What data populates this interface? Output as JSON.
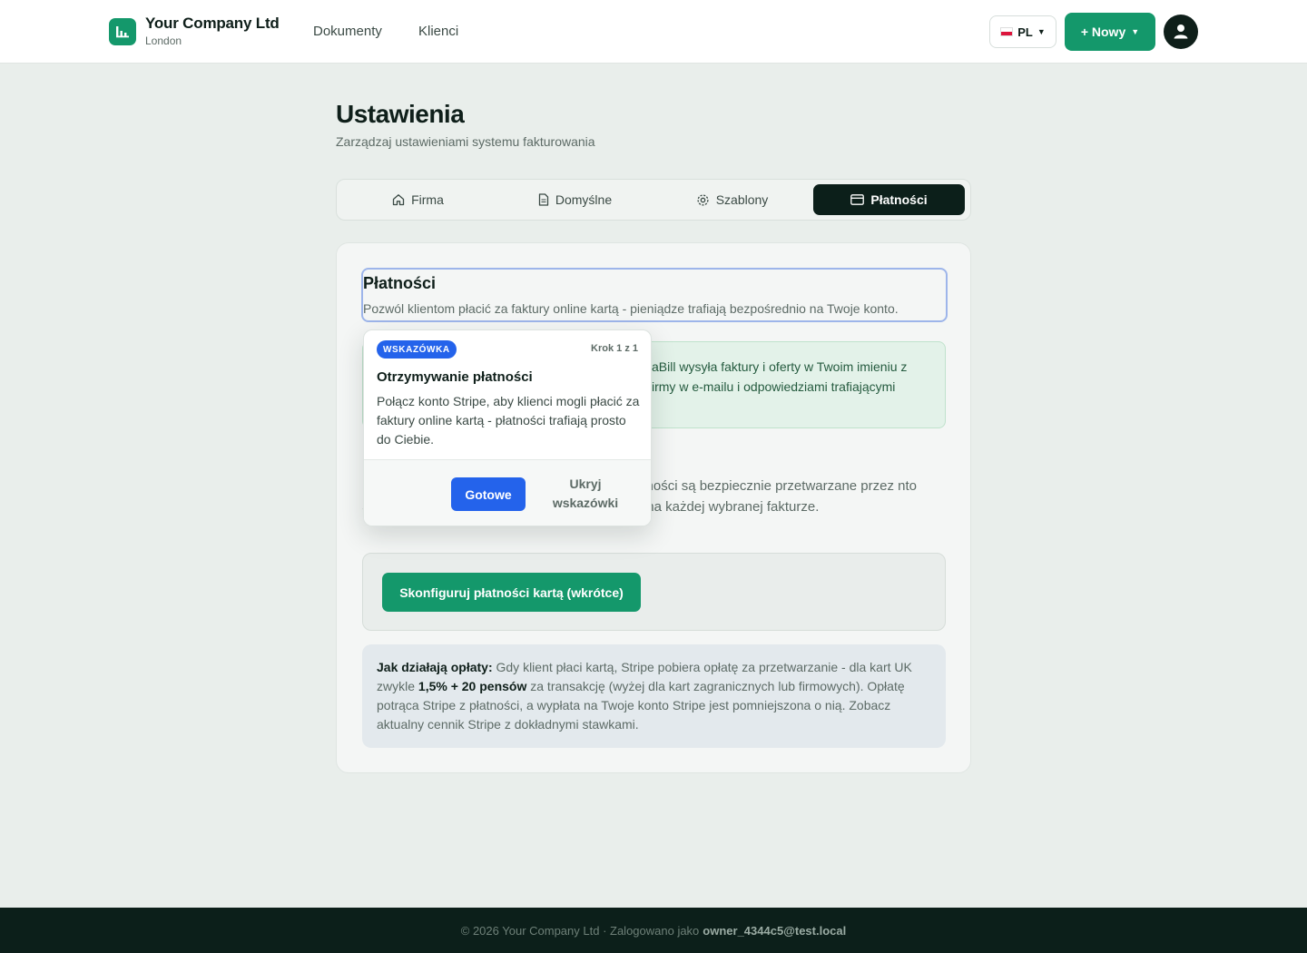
{
  "header": {
    "company_name": "Your Company Ltd",
    "company_city": "London",
    "nav": [
      "Dokumenty",
      "Klienci"
    ],
    "language": "PL",
    "new_button": "+ Nowy"
  },
  "page": {
    "title": "Ustawienia",
    "subtitle": "Zarządzaj ustawieniami systemu fakturowania"
  },
  "tabs": [
    {
      "label": "Firma",
      "icon": "home-icon",
      "active": false
    },
    {
      "label": "Domyślne",
      "icon": "document-icon",
      "active": false
    },
    {
      "label": "Szablony",
      "icon": "gear-icon",
      "active": false
    },
    {
      "label": "Płatności",
      "icon": "credit-card-icon",
      "active": true
    }
  ],
  "section": {
    "title": "Płatności",
    "description": "Pozwól klientom płacić za faktury online kartą - pieniądze trafiają bezpośrednio na Twoje konto."
  },
  "info_box": {
    "text": "aBill wysyła faktury i oferty w Twoim imieniu z irmy w e-mailu i odpowiedziami trafiającymi"
  },
  "body_text": "atności są bezpiecznie przetwarzane przez nto Stripe. Otrzymujesz bezpieczny link \"Pay now\" na każdej wybranej fakturze.",
  "setup_button": "Skonfiguruj płatności kartą (wkrótce)",
  "fees": {
    "label": "Jak działają opłaty:",
    "text_1": " Gdy klient płaci kartą, Stripe pobiera opłatę za przetwarzanie - dla kart UK zwykle ",
    "highlight": "1,5% + 20 pensów",
    "text_2": " za transakcję (wyżej dla kart zagranicznych lub firmowych). Opłatę potrąca Stripe z płatności, a wypłata na Twoje konto Stripe jest pomniejszona o nią. Zobacz aktualny cennik Stripe z dokładnymi stawkami."
  },
  "tooltip": {
    "badge": "WSKAZÓWKA",
    "step": "Krok 1 z 1",
    "title": "Otrzymywanie płatności",
    "body": "Połącz konto Stripe, aby klienci mogli płacić za faktury online kartą - płatności trafiają prosto do Ciebie.",
    "done_button": "Gotowe",
    "hide_button": "Ukryj wskazówki"
  },
  "footer": {
    "text": "© 2026 Your Company Ltd · Zalogowano jako",
    "user": "owner_4344c5@test.local"
  },
  "colors": {
    "brand": "#14986b",
    "dark": "#0c1f1a",
    "accent_blue": "#2463eb"
  }
}
